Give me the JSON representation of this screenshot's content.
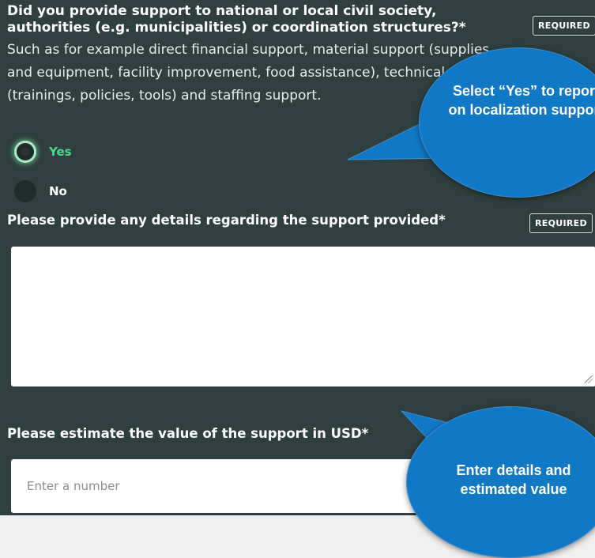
{
  "question1": {
    "title": "Did you provide support to national or local civil society, authorities (e.g. municipalities) or coordination structures?*",
    "description": "Such as for example direct financial support, material support (supplies and equipment, facility improvement, food assistance), technical support (trainings, policies, tools) and staffing support.",
    "required_badge": "REQUIRED",
    "options": [
      {
        "label": "Yes",
        "selected": true
      },
      {
        "label": "No",
        "selected": false
      }
    ]
  },
  "question2": {
    "title": "Please provide any details regarding the support provided*",
    "required_badge": "REQUIRED",
    "value": ""
  },
  "question3": {
    "title": "Please estimate the value of the support in USD*",
    "placeholder": "Enter a number",
    "value": ""
  },
  "callouts": {
    "top": "Select “Yes” to report on localization support",
    "bottom": "Enter details and estimated value"
  },
  "colors": {
    "panel_bg": "#2f3f3f",
    "selected_green": "#4fd68a",
    "callout_blue": "#1178c6"
  }
}
